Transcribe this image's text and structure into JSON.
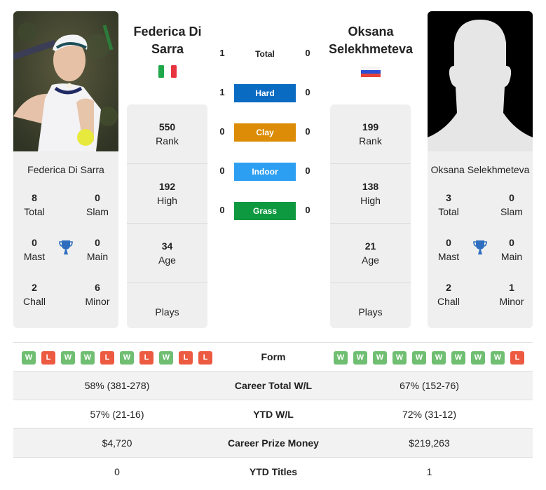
{
  "players": {
    "left": {
      "name": "Federica Di Sarra",
      "name_header": "Federica Di Sarra",
      "country_flag": "italy-flag",
      "photo": "player-photo",
      "rank": {
        "value": "550",
        "label": "Rank"
      },
      "high": {
        "value": "192",
        "label": "High"
      },
      "age": {
        "value": "34",
        "label": "Age"
      },
      "plays": {
        "label": "Plays"
      },
      "titles": {
        "total": {
          "value": "8",
          "label": "Total"
        },
        "slam": {
          "value": "0",
          "label": "Slam"
        },
        "mast": {
          "value": "0",
          "label": "Mast"
        },
        "main": {
          "value": "0",
          "label": "Main"
        },
        "chall": {
          "value": "2",
          "label": "Chall"
        },
        "minor": {
          "value": "6",
          "label": "Minor"
        }
      },
      "form": [
        "W",
        "L",
        "W",
        "W",
        "L",
        "W",
        "L",
        "W",
        "L",
        "L"
      ],
      "career_total_wl": "58% (381-278)",
      "ytd_wl": "57% (21-16)",
      "career_prize_money": "$4,720",
      "ytd_titles": "0"
    },
    "right": {
      "name": "Oksana Selekhmeteva",
      "name_header": "Oksana Selekhmeteva",
      "country_flag": "russia-flag",
      "photo": "placeholder-silhouette",
      "rank": {
        "value": "199",
        "label": "Rank"
      },
      "high": {
        "value": "138",
        "label": "High"
      },
      "age": {
        "value": "21",
        "label": "Age"
      },
      "plays": {
        "label": "Plays"
      },
      "titles": {
        "total": {
          "value": "3",
          "label": "Total"
        },
        "slam": {
          "value": "0",
          "label": "Slam"
        },
        "mast": {
          "value": "0",
          "label": "Mast"
        },
        "main": {
          "value": "0",
          "label": "Main"
        },
        "chall": {
          "value": "2",
          "label": "Chall"
        },
        "minor": {
          "value": "1",
          "label": "Minor"
        }
      },
      "form": [
        "W",
        "W",
        "W",
        "W",
        "W",
        "W",
        "W",
        "W",
        "W",
        "L"
      ],
      "career_total_wl": "67% (152-76)",
      "ytd_wl": "72% (31-12)",
      "career_prize_money": "$219,263",
      "ytd_titles": "1"
    }
  },
  "h2h": [
    {
      "label": "Total",
      "left": "1",
      "right": "0",
      "color": ""
    },
    {
      "label": "Hard",
      "left": "1",
      "right": "0",
      "color": "#0a6bc2"
    },
    {
      "label": "Clay",
      "left": "0",
      "right": "0",
      "color": "#dc8c06"
    },
    {
      "label": "Indoor",
      "left": "0",
      "right": "0",
      "color": "#2d9ff2"
    },
    {
      "label": "Grass",
      "left": "0",
      "right": "0",
      "color": "#0e9940"
    }
  ],
  "comparison": {
    "form_label": "Form",
    "career_total_wl_label": "Career Total W/L",
    "ytd_wl_label": "YTD W/L",
    "career_prize_money_label": "Career Prize Money",
    "ytd_titles_label": "YTD Titles"
  },
  "colors": {
    "win": "#6fbe72",
    "loss": "#ec5a41",
    "trophy": "#2f6ebf",
    "card_bg": "#efefef"
  }
}
